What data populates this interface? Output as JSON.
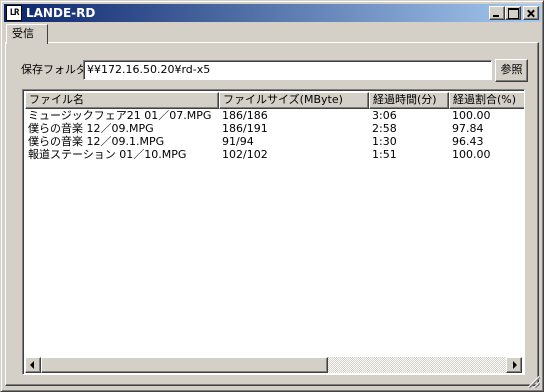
{
  "window": {
    "title": "LANDE-RD",
    "icon_name": "app-icon",
    "icon_text": "LR",
    "controls": [
      "minimize-icon",
      "maximize-icon",
      "close-icon"
    ]
  },
  "tabs": [
    {
      "label": "受信",
      "selected": true
    }
  ],
  "folder": {
    "label": "保存フォルダ",
    "value": "¥¥172.16.50.20¥rd-x5",
    "browse_label": "参照"
  },
  "list": {
    "columns": [
      "ファイル名",
      "ファイルサイズ(MByte)",
      "経過時間(分)",
      "経過割合(%)"
    ],
    "rows": [
      [
        "ミュージックフェア21 01／07.MPG",
        "186/186",
        "3:06",
        "100.00"
      ],
      [
        "僕らの音楽 12／09.MPG",
        "186/191",
        "2:58",
        "97.84"
      ],
      [
        "僕らの音楽 12／09.1.MPG",
        "91/94",
        "1:30",
        "96.43"
      ],
      [
        "報道ステーション 01／10.MPG",
        "102/102",
        "1:51",
        "100.00"
      ]
    ]
  },
  "colors": {
    "face": "#d4d0c8",
    "title_start": "#0a246a",
    "title_end": "#a6caf0"
  }
}
